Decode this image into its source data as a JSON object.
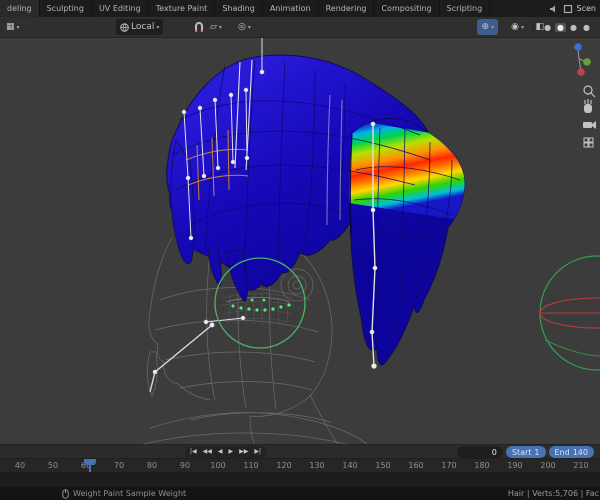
{
  "topbar": {
    "tabs": [
      "deling",
      "Sculpting",
      "UV Editing",
      "Texture Paint",
      "Shading",
      "Animation",
      "Rendering",
      "Compositing",
      "Scripting"
    ],
    "scene_label": "Scen"
  },
  "viewport_header": {
    "orientation_label": "Local"
  },
  "timeline": {
    "playback": [
      {
        "name": "jump-start-button",
        "glyph": "|◀"
      },
      {
        "name": "prev-keyframe-button",
        "glyph": "◀◀"
      },
      {
        "name": "play-reverse-button",
        "glyph": "◀"
      },
      {
        "name": "play-button",
        "glyph": "▶"
      },
      {
        "name": "next-keyframe-button",
        "glyph": "▶▶"
      },
      {
        "name": "jump-end-button",
        "glyph": "▶|"
      }
    ],
    "frame_current": "0",
    "start_label": "Start",
    "start_value": "1",
    "end_label": "End",
    "end_value": "140",
    "ruler_numbers": [
      "40",
      "50",
      "60",
      "70",
      "80",
      "90",
      "100",
      "110",
      "120",
      "130",
      "140",
      "150",
      "160",
      "170",
      "180",
      "190",
      "200",
      "210"
    ]
  },
  "statusbar": {
    "left_text": "Weight Paint Sample Weight",
    "right_text": "Hair | Verts:5,706 | Fac"
  },
  "icons": {
    "editor_type": "▦",
    "dropdown_arrow": "▾",
    "proportional_edit": "◎",
    "gizmo": "⊕",
    "overlays": "◉",
    "xray": "◧",
    "shading_sphere": "●",
    "snap_target": "▱"
  },
  "colors": {
    "accent_blue": "#4772b3",
    "hair_weight_low_blue": "#1c10c8",
    "brush_green": "#4db36b"
  }
}
